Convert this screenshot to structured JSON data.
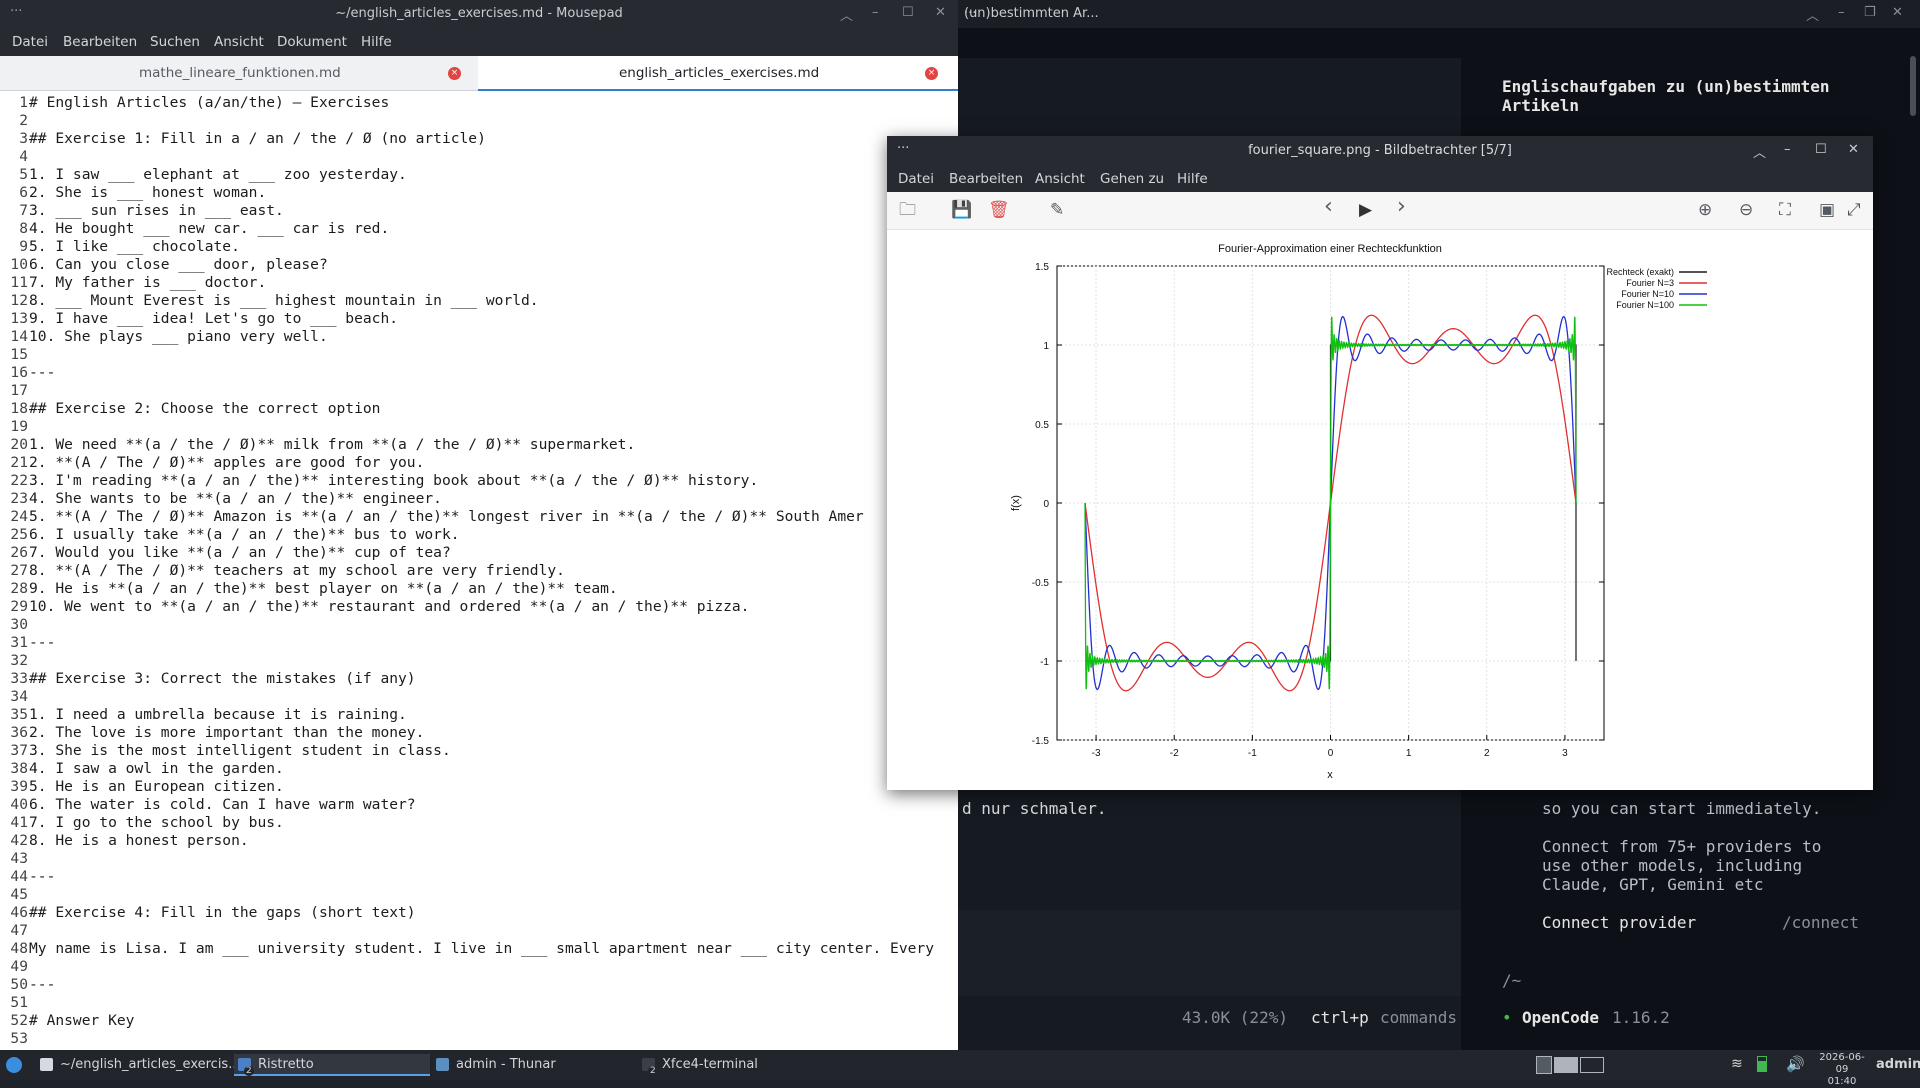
{
  "terminal": {
    "title": "(un)bestimmten Ar...",
    "heading": "Englischaufgaben zu (un)bestimmten Artikeln",
    "left_fragment": "d nur schmaler.",
    "right_lines": [
      "so you can start immediately.",
      "",
      "Connect from 75+ providers to",
      "use other models, including",
      "Claude, GPT, Gemini etc"
    ],
    "connect_label": "Connect provider",
    "connect_cmd": "/connect",
    "cwd": "/~",
    "status_tokens": "43.0K (22%)",
    "status_keys": "ctrl+p",
    "status_cmds": "commands",
    "app_bullet": "•",
    "app_name": "OpenCode",
    "app_version": "1.16.2"
  },
  "mousepad": {
    "title": "~/english_articles_exercises.md - Mousepad",
    "menu": [
      "Datei",
      "Bearbeiten",
      "Suchen",
      "Ansicht",
      "Dokument",
      "Hilfe"
    ],
    "tabs": [
      {
        "label": "mathe_lineare_funktionen.md",
        "close": "×"
      },
      {
        "label": "english_articles_exercises.md",
        "close": "×"
      }
    ],
    "lines": [
      "# English Articles (a/an/the) — Exercises",
      "",
      "## Exercise 1: Fill in a / an / the / Ø (no article)",
      "",
      "1. I saw ___ elephant at ___ zoo yesterday.",
      "2. She is ___ honest woman.",
      "3. ___ sun rises in ___ east.",
      "4. He bought ___ new car. ___ car is red.",
      "5. I like ___ chocolate.",
      "6. Can you close ___ door, please?",
      "7. My father is ___ doctor.",
      "8. ___ Mount Everest is ___ highest mountain in ___ world.",
      "9. I have ___ idea! Let's go to ___ beach.",
      "10. She plays ___ piano very well.",
      "",
      "---",
      "",
      "## Exercise 2: Choose the correct option",
      "",
      "1. We need **(a / the / Ø)** milk from **(a / the / Ø)** supermarket.",
      "2. **(A / The / Ø)** apples are good for you.",
      "3. I'm reading **(a / an / the)** interesting book about **(a / the / Ø)** history.",
      "4. She wants to be **(a / an / the)** engineer.",
      "5. **(A / The / Ø)** Amazon is **(a / an / the)** longest river in **(a / the / Ø)** South Amer",
      "6. I usually take **(a / an / the)** bus to work.",
      "7. Would you like **(a / an / the)** cup of tea?",
      "8. **(A / The / Ø)** teachers at my school are very friendly.",
      "9. He is **(a / an / the)** best player on **(a / an / the)** team.",
      "10. We went to **(a / an / the)** restaurant and ordered **(a / an / the)** pizza.",
      "",
      "---",
      "",
      "## Exercise 3: Correct the mistakes (if any)",
      "",
      "1. I need a umbrella because it is raining.",
      "2. The love is more important than the money.",
      "3. She is the most intelligent student in class.",
      "4. I saw a owl in the garden.",
      "5. He is an European citizen.",
      "6. The water is cold. Can I have warm water?",
      "7. I go to the school by bus.",
      "8. He is a honest person.",
      "",
      "---",
      "",
      "## Exercise 4: Fill in the gaps (short text)",
      "",
      "My name is Lisa. I am ___ university student. I live in ___ small apartment near ___ city center. Every",
      "",
      "---",
      "",
      "# Answer Key",
      ""
    ]
  },
  "viewer": {
    "title": "fourier_square.png - Bildbetrachter [5/7]",
    "menu": [
      "Datei",
      "Bearbeiten",
      "Ansicht",
      "Gehen zu",
      "Hilfe"
    ],
    "toolbar": {
      "open": "🗀",
      "save": "💾",
      "delete": "🗑",
      "edit": "✎",
      "prev": "‹",
      "play": "▶",
      "next": "›",
      "zoom_in": "⊕",
      "zoom_out": "⊖",
      "zoom_fit": "⛶",
      "zoom_100": "▣",
      "fullscreen": "⤢"
    }
  },
  "chart_data": {
    "type": "line",
    "title": "Fourier-Approximation einer Rechteckfunktion",
    "xlabel": "x",
    "ylabel": "f(x)",
    "xlim": [
      -3.5,
      3.5
    ],
    "ylim": [
      -1.5,
      1.5
    ],
    "xticks": [
      "-3",
      "-2",
      "-1",
      "0",
      "1",
      "2",
      "3"
    ],
    "yticks": [
      "1.5",
      "1",
      "0.5",
      "0",
      "-0.5",
      "-1",
      "-1.5"
    ],
    "grid": true,
    "legend_position": "outside-top-right",
    "series": [
      {
        "name": "Rechteck (exakt)",
        "color": "#1a1a1a",
        "fn": "square"
      },
      {
        "name": "Fourier N=3",
        "color": "#e03030",
        "fn": "fourier",
        "N": 3
      },
      {
        "name": "Fourier N=10",
        "color": "#2030d0",
        "fn": "fourier",
        "N": 10
      },
      {
        "name": "Fourier N=100",
        "color": "#10c010",
        "fn": "fourier",
        "N": 100
      }
    ]
  },
  "taskbar": {
    "tasks": [
      {
        "label": "~/english_articles_exercis..."
      },
      {
        "label": "Ristretto",
        "badge": "2"
      },
      {
        "label": "admin - Thunar"
      },
      {
        "label": "Xfce4-terminal",
        "badge": "2"
      }
    ],
    "date": "2026-06-09",
    "time": "01:40",
    "user": "admin"
  }
}
